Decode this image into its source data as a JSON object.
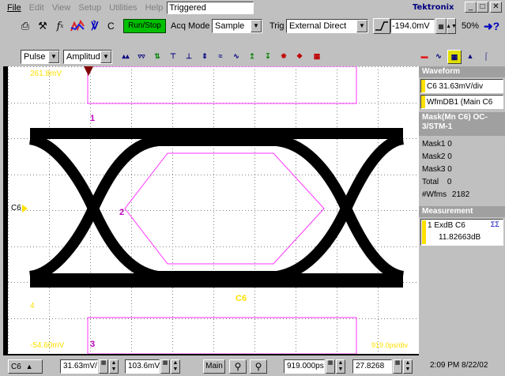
{
  "menu": {
    "items": [
      "File",
      "Edit",
      "View",
      "Setup",
      "Utilities",
      "Help"
    ],
    "status": "Triggered",
    "brand": "Tektronix"
  },
  "toolbar1": {
    "c_label": "C",
    "run_stop": "Run/Stop",
    "acq_mode_label": "Acq Mode",
    "acq_mode_value": "Sample",
    "trig_label": "Trig",
    "trig_value": "External Direct",
    "trig_level": "-194.0mV",
    "zoom": "50%"
  },
  "toolbar2": {
    "pulse": "Pulse",
    "amplitude": "Amplitude"
  },
  "scope": {
    "top_label": "261.8mV",
    "bottom_label": "-54.60mV",
    "right_bottom_label": "919.0ps/div",
    "channel_marker": "C6",
    "mask_labels": [
      "1",
      "2",
      "3"
    ],
    "ref_label": "C6",
    "ground_marker": "4"
  },
  "panel": {
    "waveform_header": "Waveform",
    "waveform_items": [
      "C6 31.63mV/div",
      "WfmDB1 (Main C6"
    ],
    "mask_header": "Mask(Mn C6) OC-3/STM-1",
    "mask_rows": [
      {
        "label": "Mask1",
        "value": "0"
      },
      {
        "label": "Mask2",
        "value": "0"
      },
      {
        "label": "Mask3",
        "value": "0"
      },
      {
        "label": "Total",
        "value": "0"
      },
      {
        "label": "#Wfms",
        "value": "2182"
      }
    ],
    "measurement_header": "Measurement",
    "measurement_item": "1 ExdB  C6",
    "measurement_value": "11.82663dB"
  },
  "bottom": {
    "channel": "C6",
    "scale": "31.63mV/",
    "offset": "103.6mV",
    "main": "Main",
    "time_pos": "919.000ps",
    "time_delay": "27.8268",
    "clock": "2:09 PM 8/22/02"
  },
  "colors": {
    "mask": "#ff33ff",
    "eye": "#000000",
    "grid": "#808080",
    "channel": "#ffe000",
    "runstop": "#00c000"
  }
}
